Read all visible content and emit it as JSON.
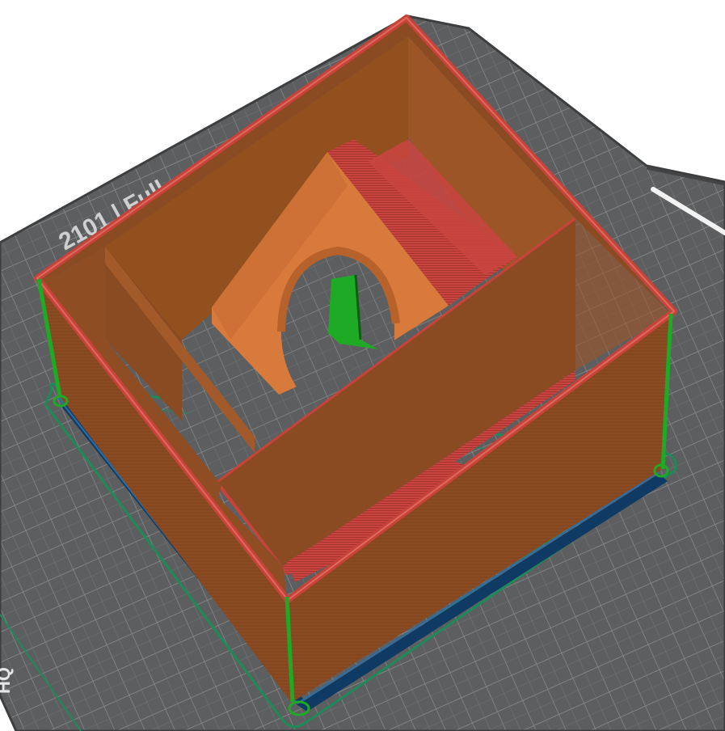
{
  "scene": {
    "view": "slicer-3d-preview",
    "bed_text_top": "2101 | Full",
    "bed_text_corner": "HQ",
    "colors": {
      "bed": "#5d5e5f",
      "bed_grid": "#8c8d8e",
      "bed_frame": "#3d3e3f",
      "outer_wall": "#8a4a22",
      "inner_wall": "#a35a2a",
      "top_edge": "#c7433a",
      "overhang": "#c8453f",
      "perimeter_seam": "#1faa25",
      "skirt": "#1d8a5a",
      "brim": "#0f3a63",
      "bridge": "#d77a3c"
    },
    "layers": [
      "outer-wall",
      "inner-wall",
      "overhang-perimeter",
      "bridge-infill",
      "skirt",
      "brim",
      "support"
    ]
  }
}
